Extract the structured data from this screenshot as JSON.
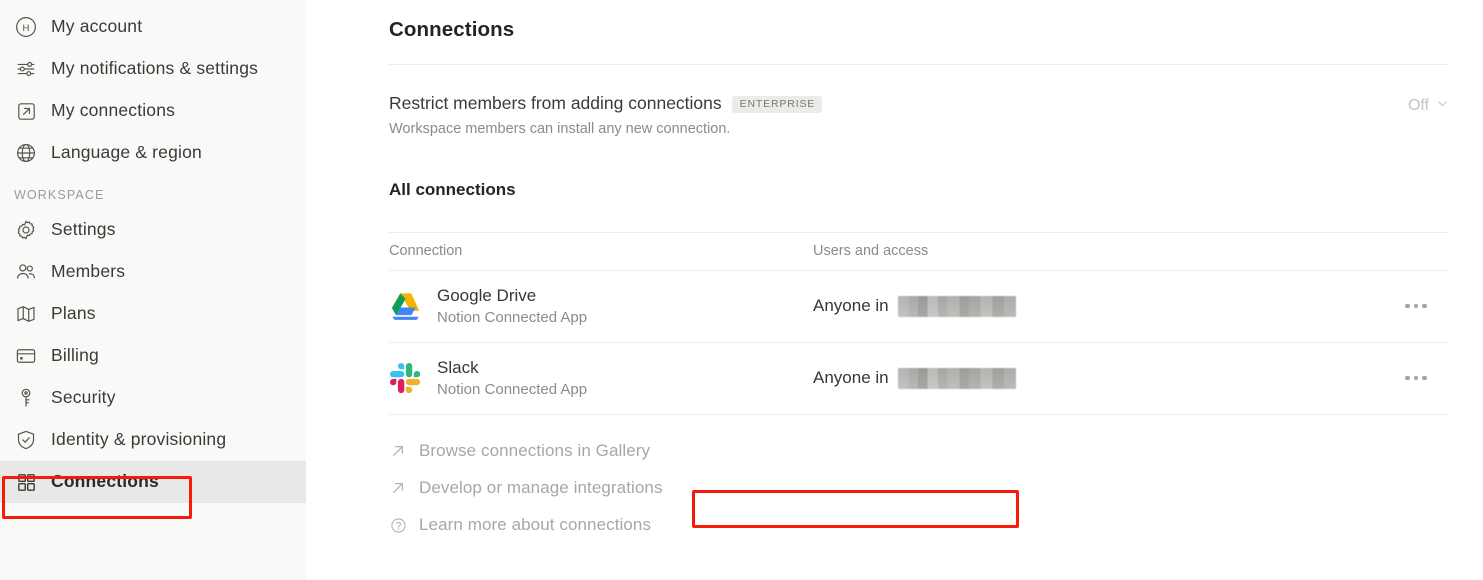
{
  "sidebar": {
    "personal_items": [
      {
        "label": "My account",
        "icon": "avatar-initial-icon",
        "initial": "H"
      },
      {
        "label": "My notifications & settings",
        "icon": "sliders-icon"
      },
      {
        "label": "My connections",
        "icon": "arrow-out-box-icon"
      },
      {
        "label": "Language & region",
        "icon": "globe-icon"
      }
    ],
    "section_label": "WORKSPACE",
    "workspace_items": [
      {
        "label": "Settings",
        "icon": "gear-icon"
      },
      {
        "label": "Members",
        "icon": "people-icon"
      },
      {
        "label": "Plans",
        "icon": "map-icon"
      },
      {
        "label": "Billing",
        "icon": "credit-card-icon"
      },
      {
        "label": "Security",
        "icon": "key-icon"
      },
      {
        "label": "Identity & provisioning",
        "icon": "shield-check-icon"
      },
      {
        "label": "Connections",
        "icon": "grid-squares-icon",
        "selected": true
      }
    ]
  },
  "main": {
    "title": "Connections",
    "restrict": {
      "title": "Restrict members from adding connections",
      "badge": "ENTERPRISE",
      "description": "Workspace members can install any new connection.",
      "toggle_value": "Off"
    },
    "all_connections_heading": "All connections",
    "table": {
      "columns": [
        "Connection",
        "Users and access"
      ],
      "rows": [
        {
          "name": "Google Drive",
          "subtitle": "Notion Connected App",
          "logo": "google-drive-logo",
          "users_prefix": "Anyone in",
          "users_redacted": true,
          "menu": "more-options-icon"
        },
        {
          "name": "Slack",
          "subtitle": "Notion Connected App",
          "logo": "slack-logo",
          "users_prefix": "Anyone in",
          "users_redacted": true,
          "menu": "more-options-icon"
        }
      ]
    },
    "links": [
      {
        "label": "Browse connections in Gallery",
        "icon": "arrow-up-right-icon"
      },
      {
        "label": "Develop or manage integrations",
        "icon": "arrow-up-right-icon",
        "highlighted": true
      },
      {
        "label": "Learn more about connections",
        "icon": "question-circle-icon"
      }
    ]
  },
  "annotations": {
    "highlight_color": "#f61a0a",
    "boxes": [
      "sidebar-item-connections",
      "link-develop-or-manage-integrations"
    ]
  }
}
